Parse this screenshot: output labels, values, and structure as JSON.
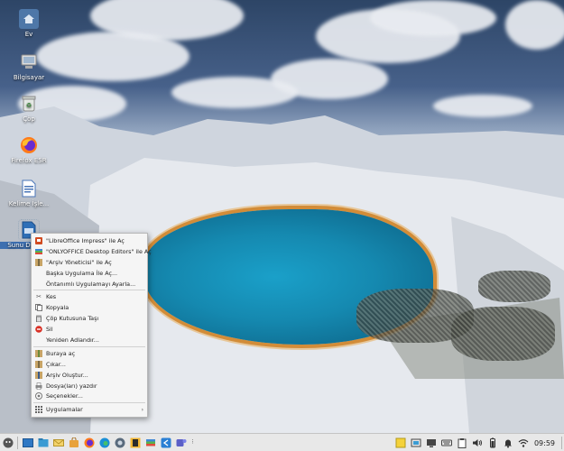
{
  "desktop": {
    "icons": [
      {
        "label": "Ev",
        "icon": "home-folder-icon"
      },
      {
        "label": "Bilgisayar",
        "icon": "computer-icon"
      },
      {
        "label": "Çöp",
        "icon": "trash-icon"
      },
      {
        "label": "Firefox ESR",
        "icon": "firefox-icon"
      },
      {
        "label": "Kelime İşle...",
        "icon": "document-icon"
      },
      {
        "label": "Sunu Dosyası",
        "icon": "presentation-icon"
      }
    ]
  },
  "context_menu": {
    "open_with_impress": "\"LibreOffice Impress\" ile Aç",
    "open_with_onlyoffice": "\"ONLYOFFICE Desktop Editors\" ile Aç",
    "open_with_archive": "\"Arşiv Yöneticisi\" ile Aç",
    "open_with_other": "Başka Uygulama İle Aç...",
    "default_app": "Öntanımlı Uygulamayı Ayarla...",
    "cut": "Kes",
    "copy": "Kopyala",
    "move_to_trash": "Çöp Kutusuna Taşı",
    "delete": "Sil",
    "rename": "Yeniden Adlandır...",
    "open_here": "Buraya aç",
    "extract": "Çıkar...",
    "create_archive": "Arşiv Oluştur...",
    "print": "Dosya(ları) yazdır",
    "options": "Seçenekler...",
    "applications": "Uygulamalar"
  },
  "taskbar": {
    "clock": "09:59"
  },
  "colors": {
    "menu_bg": "#f5f5f5",
    "taskbar_bg": "#e8e8e8",
    "lake": "#1589b0"
  }
}
